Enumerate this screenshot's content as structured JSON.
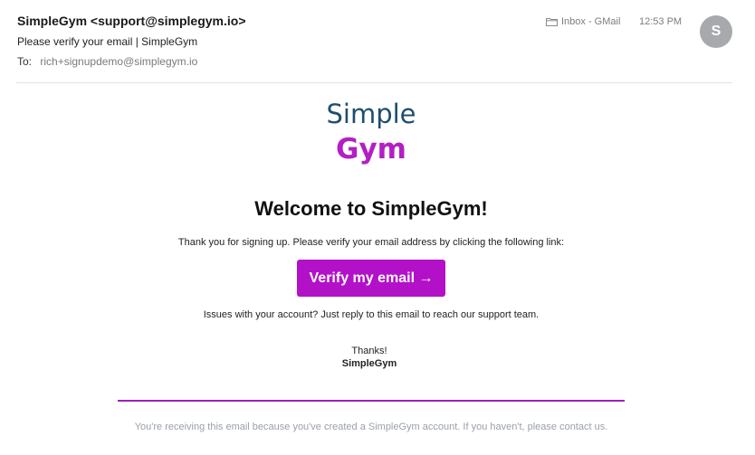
{
  "header": {
    "sender": "SimpleGym <support@simplegym.io>",
    "subject": "Please verify your email | SimpleGym",
    "to_label": "To:",
    "to_value": "rich+signupdemo@simplegym.io",
    "mailbox": "Inbox - GMail",
    "time": "12:53 PM",
    "avatar_initial": "S",
    "avatar_color": "#a7a9ad",
    "mailbox_icon": "folder-icon"
  },
  "body": {
    "logo_line1": "Simple",
    "logo_line2": "Gym",
    "title": "Welcome to SimpleGym!",
    "intro": "Thank you for signing up. Please verify your email address by clicking the following link:",
    "verify_button": "Verify my email →",
    "support": "Issues with your account? Just reply to this email to reach our support team.",
    "thanks": "Thanks!",
    "signature": "SimpleGym",
    "footer_note": "You're receiving this email because you've created a SimpleGym account. If you haven't, please contact us."
  },
  "colors": {
    "brand_purple": "#b311c8",
    "brand_navy": "#1f4e6e"
  }
}
